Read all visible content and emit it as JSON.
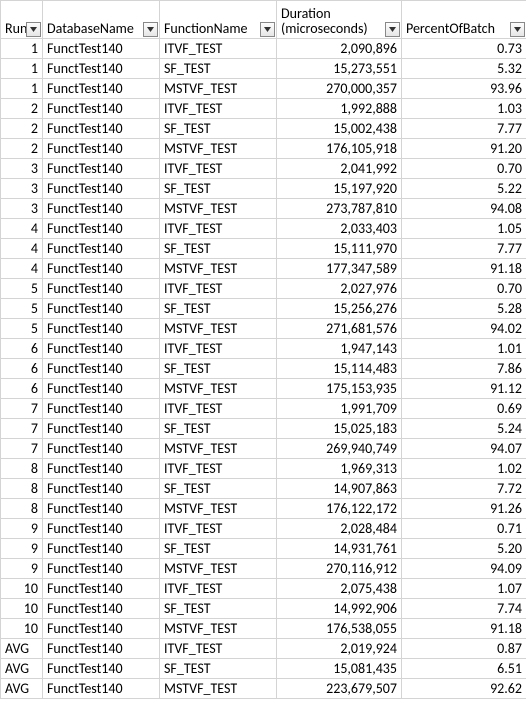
{
  "headers": {
    "run": "Run",
    "db": "DatabaseName",
    "func": "FunctionName",
    "dur": "Duration (microseconds)",
    "pct": "PercentOfBatch"
  },
  "rows": [
    {
      "run": "1",
      "db": "FunctTest140",
      "func": "ITVF_TEST",
      "dur": "2,090,896",
      "pct": "0.73"
    },
    {
      "run": "1",
      "db": "FunctTest140",
      "func": "SF_TEST",
      "dur": "15,273,551",
      "pct": "5.32"
    },
    {
      "run": "1",
      "db": "FunctTest140",
      "func": "MSTVF_TEST",
      "dur": "270,000,357",
      "pct": "93.96"
    },
    {
      "run": "2",
      "db": "FunctTest140",
      "func": "ITVF_TEST",
      "dur": "1,992,888",
      "pct": "1.03"
    },
    {
      "run": "2",
      "db": "FunctTest140",
      "func": "SF_TEST",
      "dur": "15,002,438",
      "pct": "7.77"
    },
    {
      "run": "2",
      "db": "FunctTest140",
      "func": "MSTVF_TEST",
      "dur": "176,105,918",
      "pct": "91.20"
    },
    {
      "run": "3",
      "db": "FunctTest140",
      "func": "ITVF_TEST",
      "dur": "2,041,992",
      "pct": "0.70"
    },
    {
      "run": "3",
      "db": "FunctTest140",
      "func": "SF_TEST",
      "dur": "15,197,920",
      "pct": "5.22"
    },
    {
      "run": "3",
      "db": "FunctTest140",
      "func": "MSTVF_TEST",
      "dur": "273,787,810",
      "pct": "94.08"
    },
    {
      "run": "4",
      "db": "FunctTest140",
      "func": "ITVF_TEST",
      "dur": "2,033,403",
      "pct": "1.05"
    },
    {
      "run": "4",
      "db": "FunctTest140",
      "func": "SF_TEST",
      "dur": "15,111,970",
      "pct": "7.77"
    },
    {
      "run": "4",
      "db": "FunctTest140",
      "func": "MSTVF_TEST",
      "dur": "177,347,589",
      "pct": "91.18"
    },
    {
      "run": "5",
      "db": "FunctTest140",
      "func": "ITVF_TEST",
      "dur": "2,027,976",
      "pct": "0.70"
    },
    {
      "run": "5",
      "db": "FunctTest140",
      "func": "SF_TEST",
      "dur": "15,256,276",
      "pct": "5.28"
    },
    {
      "run": "5",
      "db": "FunctTest140",
      "func": "MSTVF_TEST",
      "dur": "271,681,576",
      "pct": "94.02"
    },
    {
      "run": "6",
      "db": "FunctTest140",
      "func": "ITVF_TEST",
      "dur": "1,947,143",
      "pct": "1.01"
    },
    {
      "run": "6",
      "db": "FunctTest140",
      "func": "SF_TEST",
      "dur": "15,114,483",
      "pct": "7.86"
    },
    {
      "run": "6",
      "db": "FunctTest140",
      "func": "MSTVF_TEST",
      "dur": "175,153,935",
      "pct": "91.12"
    },
    {
      "run": "7",
      "db": "FunctTest140",
      "func": "ITVF_TEST",
      "dur": "1,991,709",
      "pct": "0.69"
    },
    {
      "run": "7",
      "db": "FunctTest140",
      "func": "SF_TEST",
      "dur": "15,025,183",
      "pct": "5.24"
    },
    {
      "run": "7",
      "db": "FunctTest140",
      "func": "MSTVF_TEST",
      "dur": "269,940,749",
      "pct": "94.07"
    },
    {
      "run": "8",
      "db": "FunctTest140",
      "func": "ITVF_TEST",
      "dur": "1,969,313",
      "pct": "1.02"
    },
    {
      "run": "8",
      "db": "FunctTest140",
      "func": "SF_TEST",
      "dur": "14,907,863",
      "pct": "7.72"
    },
    {
      "run": "8",
      "db": "FunctTest140",
      "func": "MSTVF_TEST",
      "dur": "176,122,172",
      "pct": "91.26"
    },
    {
      "run": "9",
      "db": "FunctTest140",
      "func": "ITVF_TEST",
      "dur": "2,028,484",
      "pct": "0.71"
    },
    {
      "run": "9",
      "db": "FunctTest140",
      "func": "SF_TEST",
      "dur": "14,931,761",
      "pct": "5.20"
    },
    {
      "run": "9",
      "db": "FunctTest140",
      "func": "MSTVF_TEST",
      "dur": "270,116,912",
      "pct": "94.09"
    },
    {
      "run": "10",
      "db": "FunctTest140",
      "func": "ITVF_TEST",
      "dur": "2,075,438",
      "pct": "1.07"
    },
    {
      "run": "10",
      "db": "FunctTest140",
      "func": "SF_TEST",
      "dur": "14,992,906",
      "pct": "7.74"
    },
    {
      "run": "10",
      "db": "FunctTest140",
      "func": "MSTVF_TEST",
      "dur": "176,538,055",
      "pct": "91.18"
    },
    {
      "run": "AVG",
      "db": "FunctTest140",
      "func": "ITVF_TEST",
      "dur": "2,019,924",
      "pct": "0.87"
    },
    {
      "run": "AVG",
      "db": "FunctTest140",
      "func": "SF_TEST",
      "dur": "15,081,435",
      "pct": "6.51"
    },
    {
      "run": "AVG",
      "db": "FunctTest140",
      "func": "MSTVF_TEST",
      "dur": "223,679,507",
      "pct": "92.62"
    }
  ]
}
